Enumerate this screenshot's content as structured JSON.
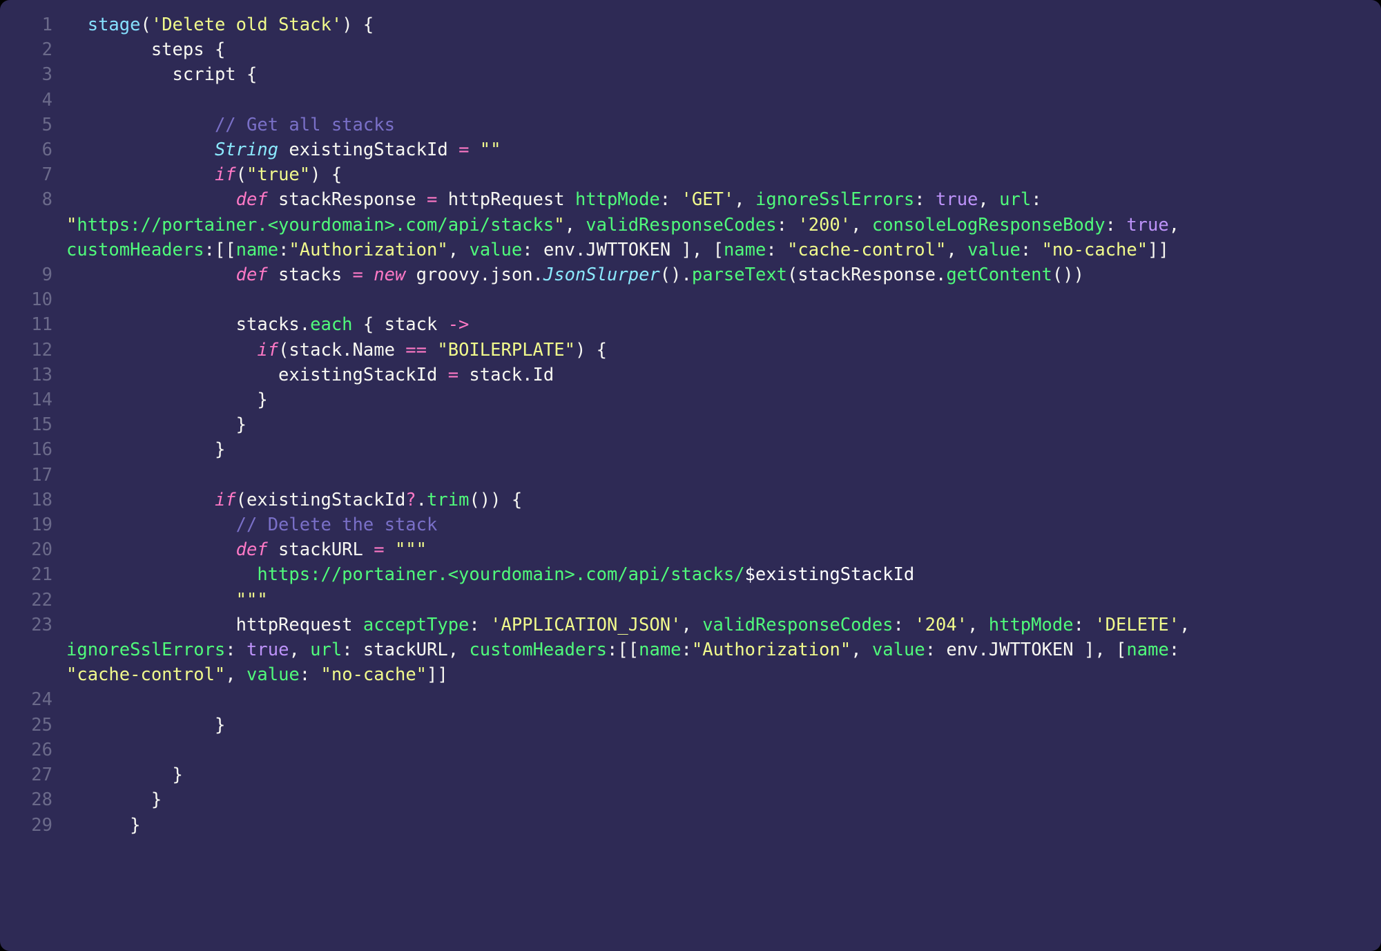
{
  "language": "groovy",
  "theme": "dracula",
  "lines": [
    {
      "n": 1,
      "tokens": [
        {
          "t": "  ",
          "c": "pn"
        },
        {
          "t": "stage",
          "c": "fn"
        },
        {
          "t": "(",
          "c": "pn"
        },
        {
          "t": "'Delete old Stack'",
          "c": "str"
        },
        {
          "t": ") {",
          "c": "pn"
        }
      ]
    },
    {
      "n": 2,
      "tokens": [
        {
          "t": "        steps {",
          "c": "pn"
        }
      ]
    },
    {
      "n": 3,
      "tokens": [
        {
          "t": "          script {",
          "c": "pn"
        }
      ]
    },
    {
      "n": 4,
      "tokens": [
        {
          "t": "",
          "c": "pn"
        }
      ]
    },
    {
      "n": 5,
      "tokens": [
        {
          "t": "              ",
          "c": "pn"
        },
        {
          "t": "// Get all stacks",
          "c": "cm"
        }
      ]
    },
    {
      "n": 6,
      "tokens": [
        {
          "t": "              ",
          "c": "pn"
        },
        {
          "t": "String",
          "c": "ty"
        },
        {
          "t": " existingStackId ",
          "c": "id"
        },
        {
          "t": "=",
          "c": "op"
        },
        {
          "t": " ",
          "c": "pn"
        },
        {
          "t": "\"\"",
          "c": "str"
        }
      ]
    },
    {
      "n": 7,
      "tokens": [
        {
          "t": "              ",
          "c": "pn"
        },
        {
          "t": "if",
          "c": "kw"
        },
        {
          "t": "(",
          "c": "pn"
        },
        {
          "t": "\"true\"",
          "c": "str"
        },
        {
          "t": ") {",
          "c": "pn"
        }
      ]
    },
    {
      "n": 8,
      "tokens": [
        {
          "t": "                ",
          "c": "pn"
        },
        {
          "t": "def",
          "c": "kw"
        },
        {
          "t": " stackResponse ",
          "c": "id"
        },
        {
          "t": "=",
          "c": "op"
        },
        {
          "t": " httpRequest ",
          "c": "id"
        },
        {
          "t": "httpMode",
          "c": "prop"
        },
        {
          "t": ": ",
          "c": "pn"
        },
        {
          "t": "'GET'",
          "c": "str"
        },
        {
          "t": ", ",
          "c": "pn"
        },
        {
          "t": "ignoreSslErrors",
          "c": "prop"
        },
        {
          "t": ": ",
          "c": "pn"
        },
        {
          "t": "true",
          "c": "bool"
        },
        {
          "t": ", ",
          "c": "pn"
        },
        {
          "t": "url",
          "c": "prop"
        },
        {
          "t": ": ",
          "c": "pn"
        }
      ],
      "wrap": [
        [
          {
            "t": "\"",
            "c": "str"
          },
          {
            "t": "https://portainer.<yourdomain>.com/api/stacks",
            "c": "gstr"
          },
          {
            "t": "\"",
            "c": "str"
          },
          {
            "t": ", ",
            "c": "pn"
          },
          {
            "t": "validResponseCodes",
            "c": "prop"
          },
          {
            "t": ": ",
            "c": "pn"
          },
          {
            "t": "'200'",
            "c": "str"
          },
          {
            "t": ", ",
            "c": "pn"
          },
          {
            "t": "consoleLogResponseBody",
            "c": "prop"
          },
          {
            "t": ": ",
            "c": "pn"
          },
          {
            "t": "true",
            "c": "bool"
          },
          {
            "t": ", ",
            "c": "pn"
          }
        ],
        [
          {
            "t": "customHeaders",
            "c": "prop"
          },
          {
            "t": ":",
            "c": "pn"
          },
          {
            "t": "[[",
            "c": "pn"
          },
          {
            "t": "name",
            "c": "prop"
          },
          {
            "t": ":",
            "c": "pn"
          },
          {
            "t": "\"Authorization\"",
            "c": "str"
          },
          {
            "t": ", ",
            "c": "pn"
          },
          {
            "t": "value",
            "c": "prop"
          },
          {
            "t": ": env.JWTTOKEN ], [",
            "c": "pn"
          },
          {
            "t": "name",
            "c": "prop"
          },
          {
            "t": ": ",
            "c": "pn"
          },
          {
            "t": "\"cache-control\"",
            "c": "str"
          },
          {
            "t": ", ",
            "c": "pn"
          },
          {
            "t": "value",
            "c": "prop"
          },
          {
            "t": ": ",
            "c": "pn"
          },
          {
            "t": "\"no-cache\"",
            "c": "str"
          },
          {
            "t": "]]",
            "c": "pn"
          }
        ]
      ]
    },
    {
      "n": 9,
      "tokens": [
        {
          "t": "                ",
          "c": "pn"
        },
        {
          "t": "def",
          "c": "kw"
        },
        {
          "t": " stacks ",
          "c": "id"
        },
        {
          "t": "=",
          "c": "op"
        },
        {
          "t": " ",
          "c": "pn"
        },
        {
          "t": "new",
          "c": "kw"
        },
        {
          "t": " groovy.json.",
          "c": "id"
        },
        {
          "t": "JsonSlurper",
          "c": "ty"
        },
        {
          "t": "().",
          "c": "pn"
        },
        {
          "t": "parseText",
          "c": "meth"
        },
        {
          "t": "(stackResponse.",
          "c": "pn"
        },
        {
          "t": "getContent",
          "c": "meth"
        },
        {
          "t": "())",
          "c": "pn"
        }
      ]
    },
    {
      "n": 10,
      "tokens": [
        {
          "t": "",
          "c": "pn"
        }
      ]
    },
    {
      "n": 11,
      "tokens": [
        {
          "t": "                stacks.",
          "c": "pn"
        },
        {
          "t": "each",
          "c": "meth"
        },
        {
          "t": " { stack ",
          "c": "pn"
        },
        {
          "t": "->",
          "c": "op"
        },
        {
          "t": "",
          "c": "pn"
        }
      ]
    },
    {
      "n": 12,
      "tokens": [
        {
          "t": "                  ",
          "c": "pn"
        },
        {
          "t": "if",
          "c": "kw"
        },
        {
          "t": "(stack.Name ",
          "c": "pn"
        },
        {
          "t": "==",
          "c": "op"
        },
        {
          "t": " ",
          "c": "pn"
        },
        {
          "t": "\"BOILERPLATE\"",
          "c": "str"
        },
        {
          "t": ") {",
          "c": "pn"
        }
      ]
    },
    {
      "n": 13,
      "tokens": [
        {
          "t": "                    existingStackId ",
          "c": "pn"
        },
        {
          "t": "=",
          "c": "op"
        },
        {
          "t": " stack.Id",
          "c": "pn"
        }
      ]
    },
    {
      "n": 14,
      "tokens": [
        {
          "t": "                  }",
          "c": "pn"
        }
      ]
    },
    {
      "n": 15,
      "tokens": [
        {
          "t": "                }",
          "c": "pn"
        }
      ]
    },
    {
      "n": 16,
      "tokens": [
        {
          "t": "              }",
          "c": "pn"
        }
      ]
    },
    {
      "n": 17,
      "tokens": [
        {
          "t": "",
          "c": "pn"
        }
      ]
    },
    {
      "n": 18,
      "tokens": [
        {
          "t": "              ",
          "c": "pn"
        },
        {
          "t": "if",
          "c": "kw"
        },
        {
          "t": "(existingStackId",
          "c": "pn"
        },
        {
          "t": "?",
          "c": "op"
        },
        {
          "t": ".",
          "c": "pn"
        },
        {
          "t": "trim",
          "c": "meth"
        },
        {
          "t": "()) {",
          "c": "pn"
        }
      ]
    },
    {
      "n": 19,
      "tokens": [
        {
          "t": "                ",
          "c": "pn"
        },
        {
          "t": "// Delete the stack",
          "c": "cm"
        }
      ]
    },
    {
      "n": 20,
      "tokens": [
        {
          "t": "                ",
          "c": "pn"
        },
        {
          "t": "def",
          "c": "kw"
        },
        {
          "t": " stackURL ",
          "c": "id"
        },
        {
          "t": "=",
          "c": "op"
        },
        {
          "t": " ",
          "c": "pn"
        },
        {
          "t": "\"\"\"",
          "c": "str"
        }
      ]
    },
    {
      "n": 21,
      "tokens": [
        {
          "t": "                  ",
          "c": "pn"
        },
        {
          "t": "https://portainer.<yourdomain>.com/api/stacks/",
          "c": "gstr"
        },
        {
          "t": "$existingStackId",
          "c": "interp"
        }
      ]
    },
    {
      "n": 22,
      "tokens": [
        {
          "t": "                ",
          "c": "pn"
        },
        {
          "t": "\"\"\"",
          "c": "str"
        }
      ]
    },
    {
      "n": 23,
      "tokens": [
        {
          "t": "                httpRequest ",
          "c": "pn"
        },
        {
          "t": "acceptType",
          "c": "prop"
        },
        {
          "t": ": ",
          "c": "pn"
        },
        {
          "t": "'APPLICATION_JSON'",
          "c": "str"
        },
        {
          "t": ", ",
          "c": "pn"
        },
        {
          "t": "validResponseCodes",
          "c": "prop"
        },
        {
          "t": ": ",
          "c": "pn"
        },
        {
          "t": "'204'",
          "c": "str"
        },
        {
          "t": ", ",
          "c": "pn"
        },
        {
          "t": "httpMode",
          "c": "prop"
        },
        {
          "t": ": ",
          "c": "pn"
        },
        {
          "t": "'DELETE'",
          "c": "str"
        },
        {
          "t": ", ",
          "c": "pn"
        }
      ],
      "wrap": [
        [
          {
            "t": "ignoreSslErrors",
            "c": "prop"
          },
          {
            "t": ": ",
            "c": "pn"
          },
          {
            "t": "true",
            "c": "bool"
          },
          {
            "t": ", ",
            "c": "pn"
          },
          {
            "t": "url",
            "c": "prop"
          },
          {
            "t": ": stackURL, ",
            "c": "pn"
          },
          {
            "t": "customHeaders",
            "c": "prop"
          },
          {
            "t": ":",
            "c": "pn"
          },
          {
            "t": "[[",
            "c": "pn"
          },
          {
            "t": "name",
            "c": "prop"
          },
          {
            "t": ":",
            "c": "pn"
          },
          {
            "t": "\"Authorization\"",
            "c": "str"
          },
          {
            "t": ", ",
            "c": "pn"
          },
          {
            "t": "value",
            "c": "prop"
          },
          {
            "t": ": env.JWTTOKEN ], [",
            "c": "pn"
          },
          {
            "t": "name",
            "c": "prop"
          },
          {
            "t": ": ",
            "c": "pn"
          }
        ],
        [
          {
            "t": "\"cache-control\"",
            "c": "str"
          },
          {
            "t": ", ",
            "c": "pn"
          },
          {
            "t": "value",
            "c": "prop"
          },
          {
            "t": ": ",
            "c": "pn"
          },
          {
            "t": "\"no-cache\"",
            "c": "str"
          },
          {
            "t": "]]",
            "c": "pn"
          }
        ]
      ]
    },
    {
      "n": 24,
      "tokens": [
        {
          "t": "",
          "c": "pn"
        }
      ]
    },
    {
      "n": 25,
      "tokens": [
        {
          "t": "              }",
          "c": "pn"
        }
      ]
    },
    {
      "n": 26,
      "tokens": [
        {
          "t": "",
          "c": "pn"
        }
      ]
    },
    {
      "n": 27,
      "tokens": [
        {
          "t": "          }",
          "c": "pn"
        }
      ]
    },
    {
      "n": 28,
      "tokens": [
        {
          "t": "        }",
          "c": "pn"
        }
      ]
    },
    {
      "n": 29,
      "tokens": [
        {
          "t": "      }",
          "c": "pn"
        }
      ]
    }
  ]
}
